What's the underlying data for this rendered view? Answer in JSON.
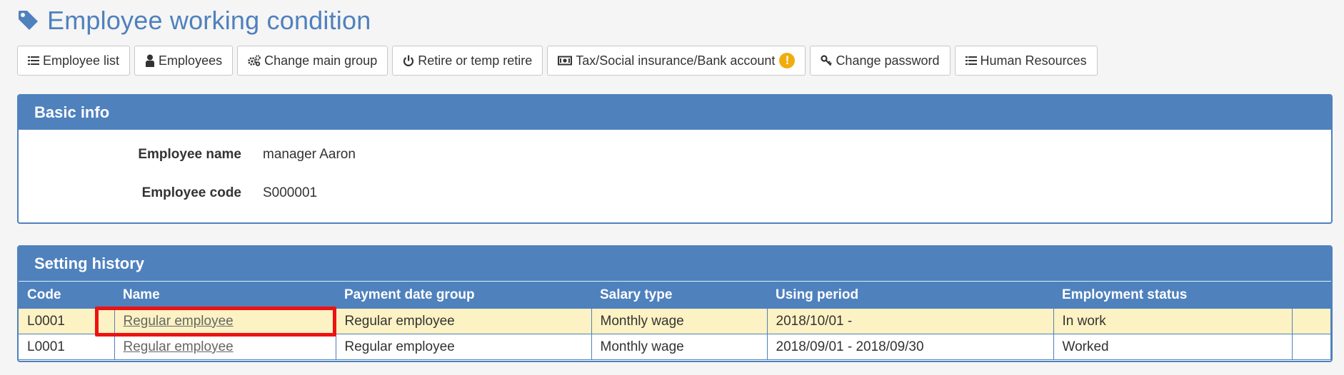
{
  "page": {
    "title": "Employee working condition",
    "title_icon": "tag-icon",
    "accent_color": "#4f81bd"
  },
  "toolbar": {
    "buttons": [
      {
        "label": "Employee list",
        "icon": "list-icon"
      },
      {
        "label": "Employees",
        "icon": "user-icon"
      },
      {
        "label": "Change main group",
        "icon": "gears-icon"
      },
      {
        "label": "Retire or temp retire",
        "icon": "power-icon"
      },
      {
        "label": "Tax/Social insurance/Bank account",
        "icon": "money-icon",
        "badge": "!"
      },
      {
        "label": "Change password",
        "icon": "key-icon"
      },
      {
        "label": "Human Resources",
        "icon": "list-icon"
      }
    ]
  },
  "basic_info": {
    "heading": "Basic info",
    "name_label": "Employee name",
    "name_value": "manager Aaron",
    "code_label": "Employee code",
    "code_value": "S000001"
  },
  "history": {
    "heading": "Setting history",
    "columns": [
      "Code",
      "Name",
      "Payment date group",
      "Salary type",
      "Using period",
      "Employment status",
      ""
    ],
    "rows": [
      {
        "code": "L0001",
        "name": "Regular employee",
        "payment_group": "Regular employee",
        "salary_type": "Monthly wage",
        "period": "2018/10/01 -",
        "status": "In work",
        "highlighted": true
      },
      {
        "code": "L0001",
        "name": "Regular employee",
        "payment_group": "Regular employee",
        "salary_type": "Monthly wage",
        "period": "2018/09/01 - 2018/09/30",
        "status": "Worked",
        "highlighted": false
      }
    ]
  }
}
